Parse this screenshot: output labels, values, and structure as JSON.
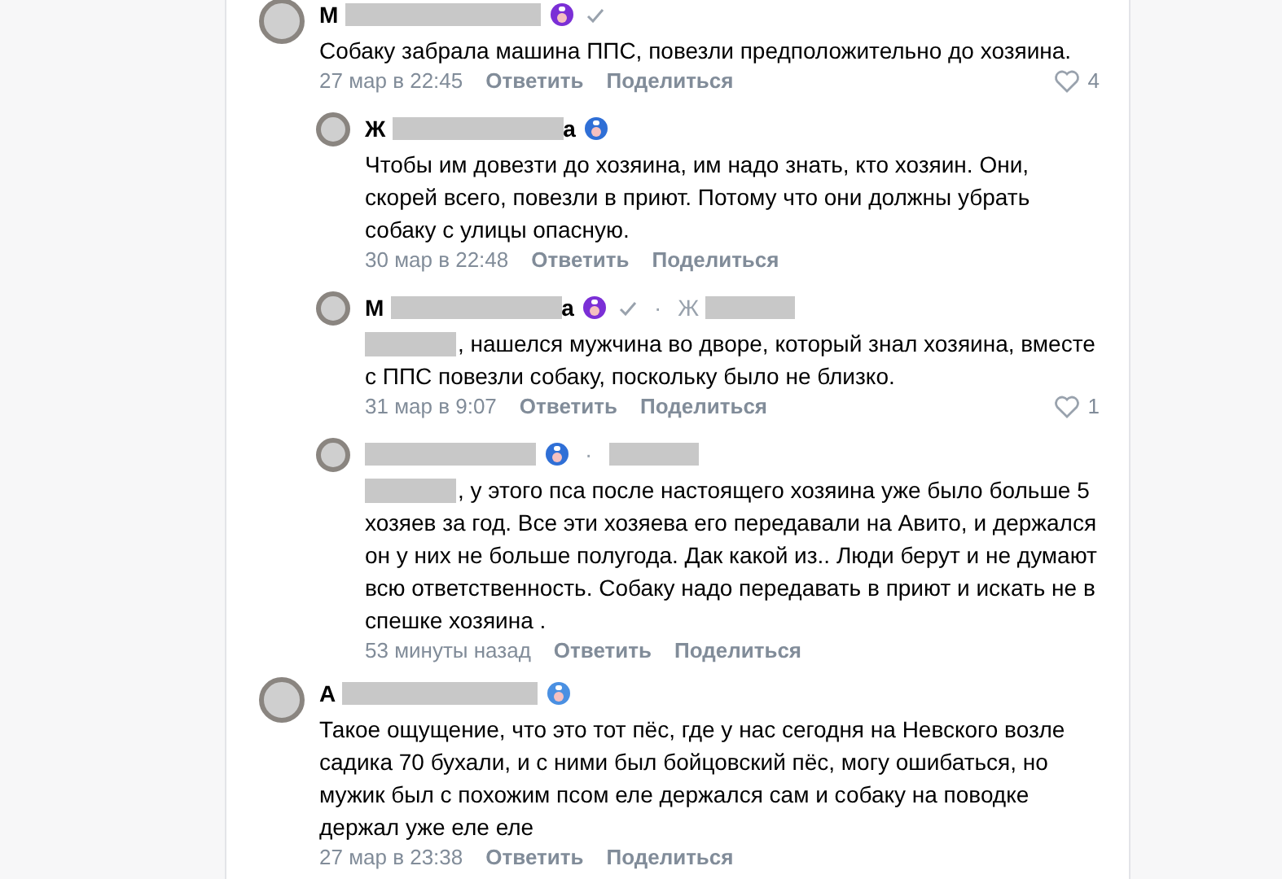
{
  "comments": [
    {
      "name_start": "М",
      "sticker": {
        "color": "#7b2fd6"
      },
      "verified": true,
      "text": "Собаку забрала машина ППС, повезли предположительно до хозяина.",
      "date": "27 мар в 22:45",
      "actions": [
        "Ответить",
        "Поделиться"
      ],
      "likes": "4",
      "children": [
        {
          "name_start": "Ж",
          "name_end": "а",
          "sticker": {
            "color": "#2f6fd6"
          },
          "text": "Чтобы им довезти до хозяина, им надо знать, кто хозяин. Они, скорей всего, повезли в приют. Потому что они должны убрать собаку с улицы опасную.",
          "date": "30 мар в 22:48",
          "actions": [
            "Ответить",
            "Поделиться"
          ]
        },
        {
          "name_start": "М",
          "name_end": "а",
          "sticker": {
            "color": "#7b2fd6"
          },
          "verified": true,
          "reply_to": {
            "separator": "·",
            "name_start": "Ж"
          },
          "mention": true,
          "text": ", нашелся мужчина во дворе, который знал хозяина, вместе с ППС повезли собаку, поскольку было не близко.",
          "date": "31 мар в 9:07",
          "actions": [
            "Ответить",
            "Поделиться"
          ],
          "likes": "1"
        },
        {
          "sticker": {
            "color": "#2f6fd6"
          },
          "reply_to": {
            "separator": "·",
            "redacted": true
          },
          "mention": true,
          "text": ", у этого пса после настоящего хозяина уже было больше 5 хозяев за год. Все эти хозяева его передавали на Авито, и держался он у них не больше полугода. Дак какой из.. Люди берут и не думают всю ответственность. Собаку надо передавать в приют и искать не в спешке хозяина .",
          "date": "53 минуты назад",
          "actions": [
            "Ответить",
            "Поделиться"
          ]
        }
      ]
    },
    {
      "name_start": "А",
      "sticker": {
        "color": "#4a90e2"
      },
      "text": "Такое ощущение, что это тот пёс, где у нас сегодня на Невского возле садика 70 бухали, и с ними был бойцовский пёс, могу ошибаться, но мужик был с похожим псом еле держался сам и собаку на поводке держал уже еле еле",
      "date": "27 мар в 23:38",
      "actions": [
        "Ответить",
        "Поделиться"
      ]
    }
  ]
}
